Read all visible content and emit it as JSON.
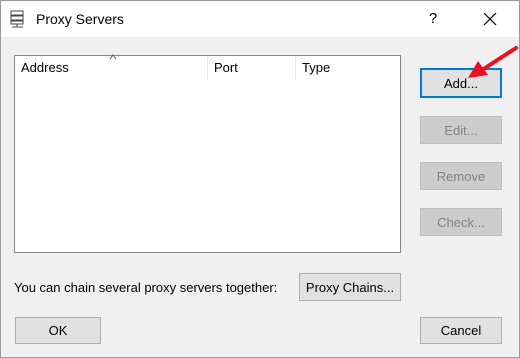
{
  "window": {
    "title": "Proxy Servers",
    "help_label": "?"
  },
  "list": {
    "columns": [
      "Address",
      "Port",
      "Type"
    ],
    "sort_column": "Address",
    "rows": []
  },
  "buttons": {
    "add": "Add...",
    "edit": "Edit...",
    "remove": "Remove",
    "check": "Check...",
    "proxy_chains": "Proxy Chains...",
    "ok": "OK",
    "cancel": "Cancel"
  },
  "chain_text": "You can chain several proxy servers together:",
  "icons": {
    "title": "server-icon",
    "close": "close-icon",
    "sort": "sort-ascending-icon",
    "annotation": "red-arrow-icon"
  },
  "colors": {
    "annotation_arrow": "#e81123",
    "default_button_border": "#0078d7"
  }
}
